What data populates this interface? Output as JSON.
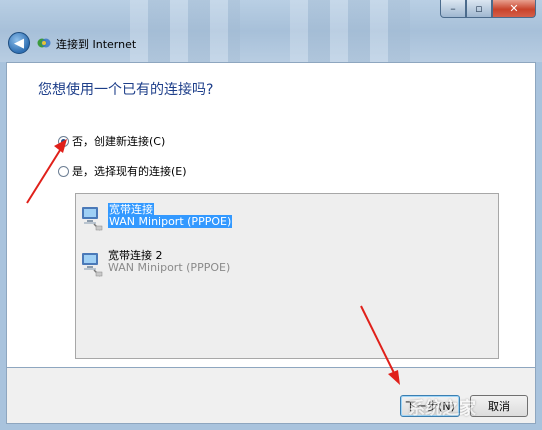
{
  "window": {
    "title": "连接到 Internet",
    "minimize_glyph": "–",
    "maximize_glyph": "▫",
    "close_glyph": "✕",
    "back_glyph": "◀"
  },
  "question": "您想使用一个已有的连接吗?",
  "options": [
    {
      "label": "否，创建新连接(C)",
      "checked": true
    },
    {
      "label": "是，选择现有的连接(E)",
      "checked": false
    }
  ],
  "connections": [
    {
      "name": "宽带连接",
      "device": "WAN Miniport (PPPOE)",
      "selected": true,
      "icon": "network-computer-icon"
    },
    {
      "name": "宽带连接 2",
      "device": "WAN Miniport (PPPOE)",
      "selected": false,
      "icon": "network-computer-icon"
    }
  ],
  "buttons": {
    "next": "下一步(N)",
    "cancel": "取消"
  },
  "annotation_color": "#e0201a",
  "watermark": "系统之家"
}
